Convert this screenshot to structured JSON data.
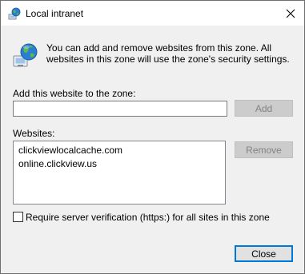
{
  "window": {
    "title": "Local intranet",
    "title_icon": "globe-network-icon",
    "close_icon": "close-icon"
  },
  "info": {
    "icon": "globe-network-icon",
    "text": "You can add and remove websites from this zone. All websites in this zone will use the zone's security settings."
  },
  "add_section": {
    "label": "Add this website to the zone:",
    "input_value": "",
    "add_button": "Add",
    "add_button_enabled": false
  },
  "websites_section": {
    "label": "Websites:",
    "items": [
      "clickviewlocalcache.com",
      "online.clickview.us"
    ],
    "remove_button": "Remove",
    "remove_button_enabled": false
  },
  "verification": {
    "label": "Require server verification (https:) for all sites in this zone",
    "checked": false
  },
  "footer": {
    "close_button": "Close"
  },
  "colors": {
    "accent": "#0078d7",
    "disabled_button": "#cccccc",
    "disabled_text": "#838383",
    "globe_blue": "#2b7fd0"
  }
}
